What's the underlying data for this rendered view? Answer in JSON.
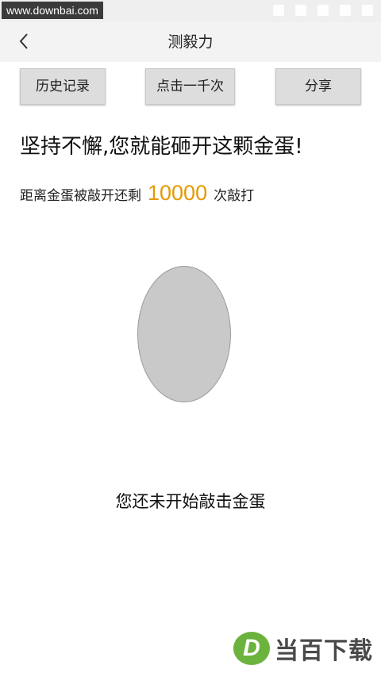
{
  "watermark": {
    "top_text": "www.downbai.com",
    "logo_letter": "D",
    "logo_text": "当百下载"
  },
  "header": {
    "title": "测毅力",
    "back_icon": "chevron-left-icon"
  },
  "buttons": {
    "history_label": "历史记录",
    "thousand_label": "点击一千次",
    "share_label": "分享"
  },
  "main": {
    "headline": "坚持不懈,您就能砸开这颗金蛋!",
    "remain_prefix": "距离金蛋被敲开还剩",
    "remain_count": "10000",
    "remain_suffix": "次敲打",
    "status_message": "您还未开始敲击金蛋"
  },
  "colors": {
    "accent": "#e59900",
    "egg_fill": "#c9c9c9",
    "logo_green": "#6cb33e"
  }
}
